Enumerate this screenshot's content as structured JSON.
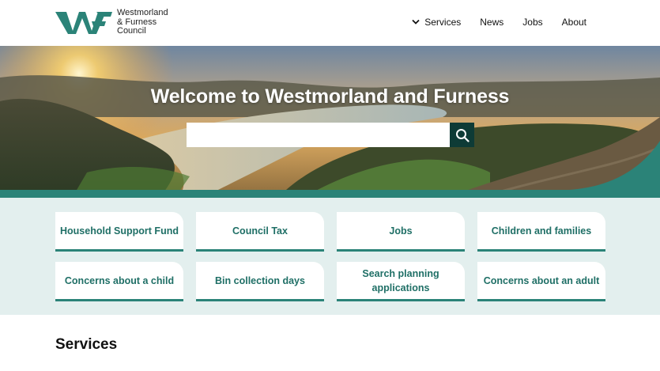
{
  "header": {
    "logo_lines": [
      "Westmorland",
      "& Furness",
      "Council"
    ]
  },
  "nav": {
    "items": [
      {
        "label": "Services",
        "has_dropdown": true
      },
      {
        "label": "News"
      },
      {
        "label": "Jobs"
      },
      {
        "label": "About"
      }
    ]
  },
  "hero": {
    "title": "Welcome to Westmorland and Furness",
    "search_placeholder": "",
    "search_icon": "search-icon"
  },
  "quick_links": [
    {
      "label": "Household Support Fund"
    },
    {
      "label": "Council Tax"
    },
    {
      "label": "Jobs"
    },
    {
      "label": "Children and families"
    },
    {
      "label": "Concerns about a child"
    },
    {
      "label": "Bin collection days"
    },
    {
      "label": "Search planning applications"
    },
    {
      "label": "Concerns about an adult"
    }
  ],
  "services": {
    "heading": "Services"
  },
  "colors": {
    "brand_teal": "#2b8378",
    "dark_teal": "#0e3b36",
    "tile_text": "#1f6f66",
    "quick_bg": "#e3efee"
  }
}
